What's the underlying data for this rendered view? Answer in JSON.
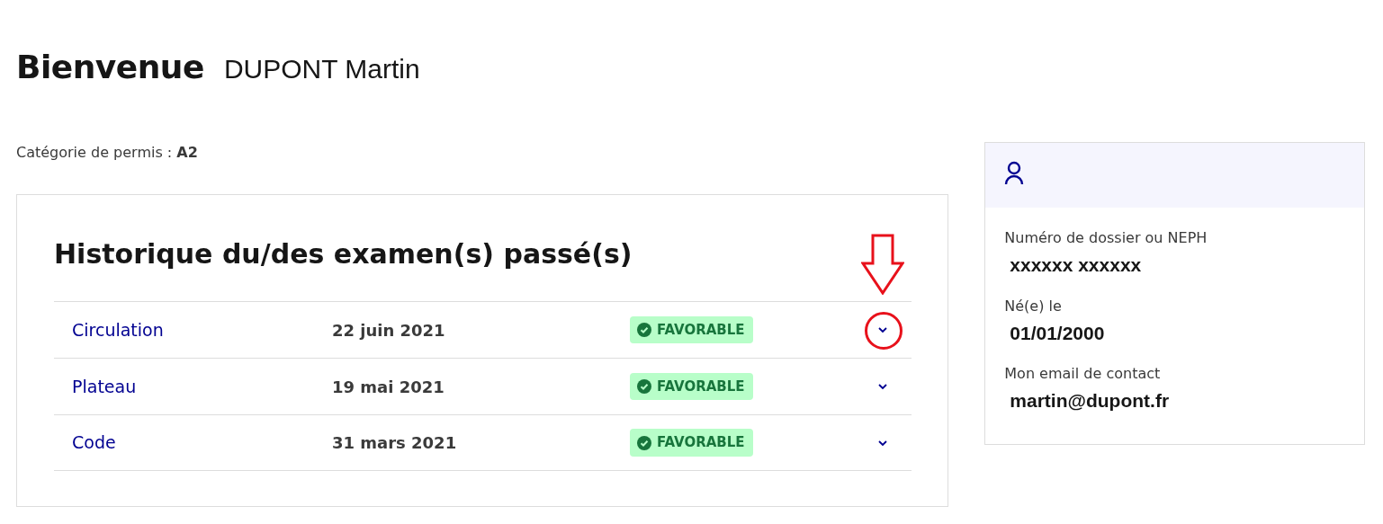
{
  "welcome": {
    "label": "Bienvenue",
    "name": "DUPONT Martin"
  },
  "category": {
    "label": "Catégorie de permis : ",
    "value": "A2"
  },
  "history": {
    "title": "Historique du/des examen(s) passé(s)",
    "exams": [
      {
        "name": "Circulation",
        "date": "22 juin 2021",
        "status": "FAVORABLE",
        "kind": "favorable",
        "highlighted": true
      },
      {
        "name": "Plateau",
        "date": "19 mai 2021",
        "status": "FAVORABLE",
        "kind": "favorable",
        "highlighted": false
      },
      {
        "name": "Code",
        "date": "31 mars 2021",
        "status": "FAVORABLE",
        "kind": "favorable",
        "highlighted": false
      }
    ]
  },
  "profile": {
    "fields": [
      {
        "label": "Numéro de dossier ou NEPH",
        "value": "xxxxxx xxxxxx"
      },
      {
        "label": "Né(e) le",
        "value": "01/01/2000"
      },
      {
        "label": "Mon email de contact",
        "value": "martin@dupont.fr"
      }
    ]
  }
}
